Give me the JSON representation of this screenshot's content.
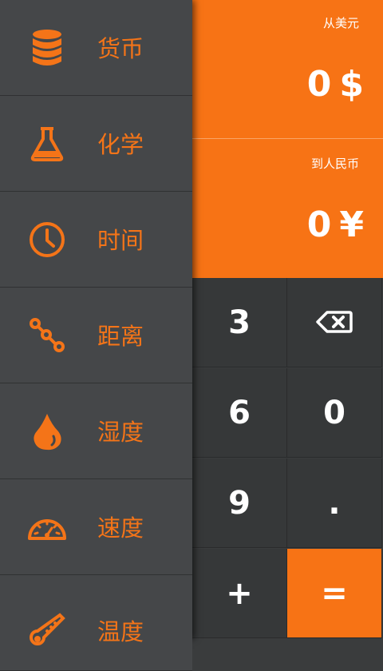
{
  "sidebar": {
    "items": [
      {
        "label": "货币",
        "icon": "coins-icon"
      },
      {
        "label": "化学",
        "icon": "flask-icon"
      },
      {
        "label": "时间",
        "icon": "clock-icon"
      },
      {
        "label": "距离",
        "icon": "route-icon"
      },
      {
        "label": "湿度",
        "icon": "droplet-icon"
      },
      {
        "label": "速度",
        "icon": "speedometer-icon"
      },
      {
        "label": "温度",
        "icon": "thermometer-icon"
      }
    ]
  },
  "display": {
    "from": {
      "label": "从美元",
      "value": "0",
      "symbol": "$"
    },
    "to": {
      "label": "到人民币",
      "value": "0",
      "symbol": "¥"
    }
  },
  "keypad": {
    "k3": "3",
    "backspace_icon": "backspace-icon",
    "k6": "6",
    "k0": "0",
    "k9": "9",
    "dot": ".",
    "plus": "+",
    "equals": "="
  },
  "colors": {
    "accent": "#f77315",
    "sidebar_bg": "#454749",
    "key_bg": "#363839"
  }
}
